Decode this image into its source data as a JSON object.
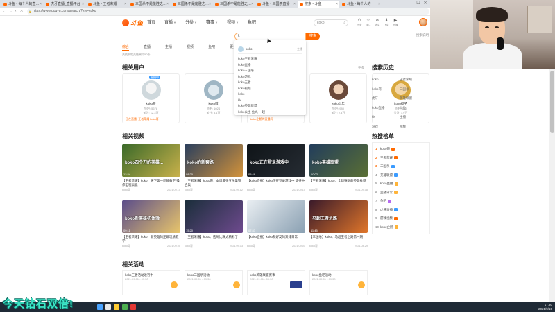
{
  "browser": {
    "tabs": [
      {
        "label": "斗鱼 - 每个人的直播平台",
        "active": false
      },
      {
        "label": "虎牙直播_直播平台",
        "active": false
      },
      {
        "label": "斗鱼 - 王者荣耀",
        "active": false
      },
      {
        "label": "三国杀不是能胜之前赛",
        "active": false
      },
      {
        "label": "三国杀不是能胜之前赛",
        "active": false
      },
      {
        "label": "三国杀不是能胜之前赛",
        "active": false
      },
      {
        "label": "斗鱼 - 三国杀直播",
        "active": false
      },
      {
        "label": "搜索 - 斗鱼",
        "active": true
      },
      {
        "label": "斗鱼 - 每个人的",
        "active": false
      }
    ],
    "address": "https://www.douyu.com/search/?kw=koko",
    "win_controls": [
      "–",
      "☐",
      "✕"
    ]
  },
  "header": {
    "logo_text": "斗鱼",
    "nav": [
      {
        "label": "首页",
        "caret": false
      },
      {
        "label": "直播",
        "caret": true
      },
      {
        "label": "分类",
        "caret": true
      },
      {
        "label": "赛事",
        "caret": true
      },
      {
        "label": "视频",
        "caret": true
      },
      {
        "label": "鱼吧",
        "caret": false
      }
    ],
    "search_placeholder": "koko",
    "icons": [
      {
        "glyph": "⏱",
        "label": "历史"
      },
      {
        "glyph": "☆",
        "label": "关注"
      },
      {
        "glyph": "✉",
        "label": "消息"
      },
      {
        "glyph": "⬇",
        "label": "下载"
      },
      {
        "glyph": "▶",
        "label": "开播"
      }
    ]
  },
  "search": {
    "value": "k",
    "button": "搜索",
    "hint": "搜索说明"
  },
  "dropdown": {
    "user_name": "koko",
    "user_tag": "主播",
    "items": [
      "koko王者荣耀",
      "koko直播",
      "koko三国杀",
      "koko游戏",
      "koko王者",
      "koko视频",
      "koko",
      "kk",
      "koko英雄联盟",
      "koko公主 鱼丸 一起"
    ]
  },
  "filters": [
    "综合",
    "直播",
    "主播",
    "视频",
    "鱼吧",
    "更多"
  ],
  "result_count": "共找到相关结果约50条",
  "sections": {
    "users_title": "相关用户",
    "users_more": "更多",
    "videos_title": "相关视频",
    "acts_title": "相关活动",
    "history_title": "搜索历史",
    "hot_title": "热搜榜单"
  },
  "users": [
    {
      "name": "koko哥",
      "line1": "鱼吧: 5678",
      "line2": "关注: 12.3万",
      "badge": "直播中",
      "live": "正在直播: 王者荣耀 koko哥"
    },
    {
      "name": "koko鲸",
      "line1": "鱼吧: 1024",
      "line2": "关注: 8.1万",
      "badge": "",
      "live": ""
    },
    {
      "name": "koko企鹅",
      "line1": "鱼吧: 3300",
      "line2": "关注: 5.2万",
      "badge": "",
      "live": "koko企鹅的直播间"
    },
    {
      "name": "koko少年",
      "line1": "鱼吧: 980",
      "line2": "关注: 2.4万",
      "badge": "",
      "live": ""
    },
    {
      "name": "koko橙子",
      "line1": "鱼吧: 760",
      "line2": "关注: 1.9万",
      "badge": "",
      "live": ""
    }
  ],
  "videos": [
    {
      "caption": "koko四个刀的英雄...",
      "duration": "12:34",
      "title": "【王者荣耀】koko：天下第一貂蝉教学 操作全程高能",
      "author": "koko哥",
      "date": "2021.09.15",
      "colors": [
        "#3b6a2a",
        "#c9b14a"
      ]
    },
    {
      "caption": "koko的新套路",
      "duration": "08:20",
      "title": "【王者荣耀】koko哥：本周最强五杀集锦合集",
      "author": "koko哥",
      "date": "2021.09.12",
      "colors": [
        "#2a3f5e",
        "#d2923a"
      ]
    },
    {
      "caption": "koko正在登录游戏中",
      "duration": "05:48",
      "title": "【koko直播】koko正在登录游戏中 等待中",
      "author": "koko哥",
      "date": "2021.09.10",
      "colors": [
        "#0f1418",
        "#262c33"
      ]
    },
    {
      "caption": "koko英雄联盟",
      "duration": "10:02",
      "title": "【王者荣耀】koko：全新赛季的英雄推荐",
      "author": "koko哥",
      "date": "2021.09.08",
      "colors": [
        "#223d5c",
        "#5a6f34"
      ]
    },
    {
      "caption": "koko新英雄初体验",
      "duration": "09:11",
      "title": "【王者荣耀】koko：新英雄的正确玩法教学",
      "author": "koko哥",
      "date": "2021.09.05",
      "colors": [
        "#5b4d8a",
        "#e8c56b"
      ]
    },
    {
      "caption": "",
      "duration": "15:20",
      "title": "【王者荣耀】koko：这局比赛太精彩了",
      "author": "koko哥",
      "date": "2021.09.03",
      "colors": [
        "#1a2e3a",
        "#6e4a8e"
      ]
    },
    {
      "caption": "",
      "duration": "07:33",
      "title": "【koko直播】koko和好友的双排日常",
      "author": "koko哥",
      "date": "2021.09.01",
      "colors": [
        "#e9eef2",
        "#8aa0b2"
      ]
    },
    {
      "caption": "马超王者之路",
      "duration": "11:45",
      "title": "【三国杀】koko：马超王者之路第一期",
      "author": "koko哥",
      "date": "2021.08.29",
      "colors": [
        "#3a1a2a",
        "#e0762a"
      ]
    }
  ],
  "history": [
    "koko",
    "王者荣耀",
    "koko哥",
    "三国杀",
    "虎牙",
    "英雄联盟",
    "koko直播",
    "斗鱼",
    "kk",
    "主播",
    "游戏",
    "视频"
  ],
  "hot": [
    {
      "label": "koko哥",
      "color": "#ff6a00"
    },
    {
      "label": "王者荣耀",
      "color": "#ff6a00"
    },
    {
      "label": "三国杀",
      "color": "#3a9bff"
    },
    {
      "label": "英雄联盟",
      "color": "#3a9bff"
    },
    {
      "label": "koko直播",
      "color": "#ffb43a"
    },
    {
      "label": "主播日常",
      "color": "#ffb43a"
    },
    {
      "label": "鱼吧",
      "color": "#b66af0"
    },
    {
      "label": "虎牙直播",
      "color": "#3a9bff"
    },
    {
      "label": "游戏视频",
      "color": "#ff6a00"
    },
    {
      "label": "koko企鹅",
      "color": "#ffb43a"
    }
  ],
  "activities": [
    {
      "title": "koko王者活动进行中",
      "sub": "2021.09.01 - 09.30",
      "icon": true
    },
    {
      "title": "koko三国杀活动",
      "sub": "2021.09.01 - 09.30",
      "icon": true
    },
    {
      "title": "koko英雄联盟赛事",
      "sub": "2021.09.01 - 09.30",
      "icon": false
    },
    {
      "title": "koko鱼吧活动",
      "sub": "2021.09.01 - 09.30",
      "icon": true
    }
  ],
  "banner": "今天钻石双倍!",
  "taskbar": {
    "time": "17:30",
    "date": "2021/9/15"
  }
}
